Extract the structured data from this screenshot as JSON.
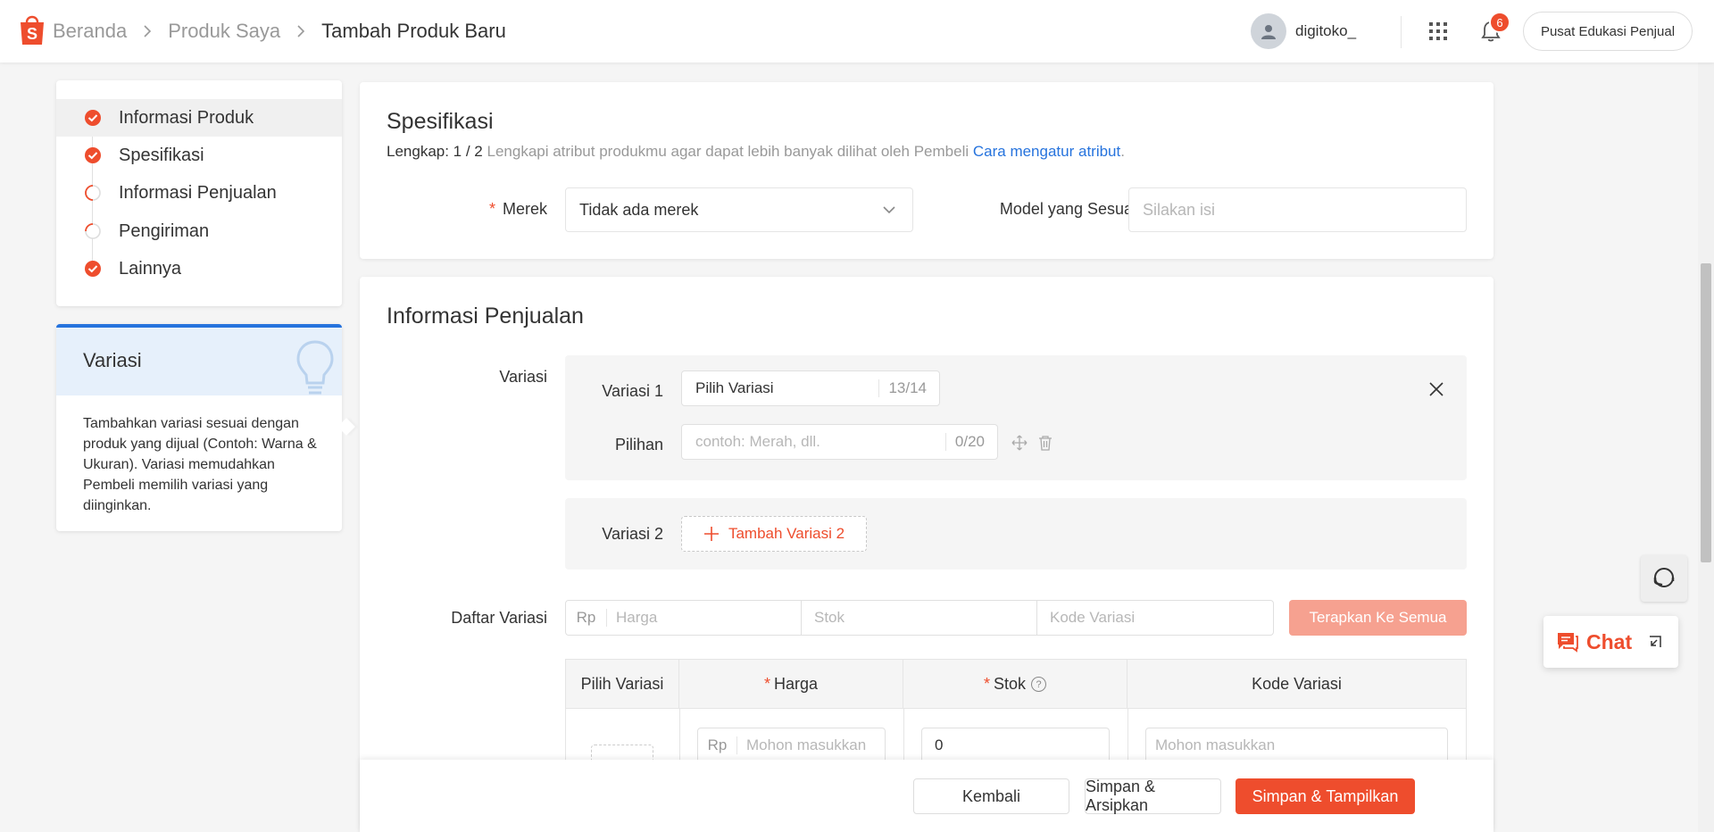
{
  "header": {
    "breadcrumbs": [
      "Beranda",
      "Produk Saya",
      "Tambah Produk Baru"
    ],
    "username": "digitoko_",
    "notification_count": "6",
    "edu_button": "Pusat Edukasi Penjual"
  },
  "sidebar": {
    "items": [
      {
        "label": "Informasi Produk",
        "status": "done"
      },
      {
        "label": "Spesifikasi",
        "status": "done"
      },
      {
        "label": "Informasi Penjualan",
        "status": "partial"
      },
      {
        "label": "Pengiriman",
        "status": "partial"
      },
      {
        "label": "Lainnya",
        "status": "done"
      }
    ]
  },
  "tip": {
    "title": "Variasi",
    "text": "Tambahkan variasi sesuai dengan produk yang dijual (Contoh: Warna & Ukuran). Variasi memudahkan Pembeli memilih variasi yang diinginkan."
  },
  "spesifikasi": {
    "title": "Spesifikasi",
    "complete_label": "Lengkap: 1 / 2",
    "hint": "Lengkapi atribut produkmu agar dapat lebih banyak dilihat oleh Pembeli",
    "link": "Cara mengatur atribut",
    "link_suffix": ".",
    "merek_label": "Merek",
    "merek_value": "Tidak ada merek",
    "model_label": "Model yang Sesuai",
    "model_placeholder": "Silakan isi"
  },
  "penjualan": {
    "title": "Informasi Penjualan",
    "variasi_label": "Variasi",
    "variasi1_label": "Variasi 1",
    "variasi1_value": "Pilih Variasi",
    "variasi1_counter": "13/14",
    "pilihan_label": "Pilihan",
    "pilihan_placeholder": "contoh: Merah, dll.",
    "pilihan_counter": "0/20",
    "variasi2_label": "Variasi 2",
    "add_variasi2": "Tambah Variasi 2",
    "daftar_label": "Daftar Variasi",
    "currency": "Rp",
    "harga_placeholder": "Harga",
    "stok_placeholder": "Stok",
    "kode_placeholder": "Kode Variasi",
    "apply_button": "Terapkan Ke Semua",
    "table": {
      "headers": [
        "Pilih Variasi",
        "Harga",
        "Stok",
        "Kode Variasi"
      ],
      "row": {
        "currency": "Rp",
        "harga_placeholder": "Mohon masukkan",
        "stok_value": "0",
        "kode_placeholder": "Mohon masukkan"
      }
    }
  },
  "footer": {
    "back": "Kembali",
    "save_archive": "Simpan & Arsipkan",
    "save_publish": "Simpan & Tampilkan"
  },
  "floating": {
    "chat": "Chat"
  },
  "colors": {
    "brand": "#ee4d2d",
    "link": "#2673dd"
  }
}
